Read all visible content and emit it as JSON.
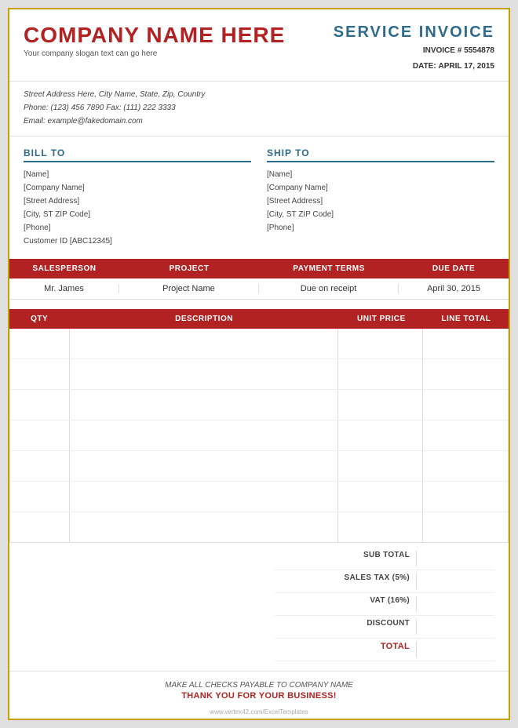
{
  "header": {
    "company_name": "COMPANY NAME HERE",
    "slogan": "Your company slogan text can go here",
    "invoice_title": "SERVICE  INVOICE",
    "invoice_number_label": "INVOICE #",
    "invoice_number": "5554878",
    "date_label": "DATE:",
    "date_value": "APRIL 17, 2015"
  },
  "contact": {
    "address": "Street Address Here, City Name, State, Zip, Country",
    "phone": "Phone: (123) 456 7890 Fax:  (111) 222 3333",
    "email": "Email: example@fakedomain.com"
  },
  "bill_to": {
    "title": "BILL TO",
    "lines": [
      "[Name]",
      "[Company Name]",
      "[Street Address]",
      "[City, ST  ZIP Code]",
      "[Phone]",
      "Customer ID [ABC12345]"
    ]
  },
  "ship_to": {
    "title": "SHIP TO",
    "lines": [
      "[Name]",
      "[Company Name]",
      "[Street Address]",
      "[City, ST  ZIP Code]",
      "[Phone]"
    ]
  },
  "info_table": {
    "headers": [
      "SALESPERSON",
      "PROJECT",
      "PAYMENT TERMS",
      "DUE DATE"
    ],
    "row": [
      "Mr. James",
      "Project Name",
      "Due on receipt",
      "April 30, 2015"
    ]
  },
  "items_table": {
    "headers": [
      "QTY",
      "DESCRIPTION",
      "UNIT PRICE",
      "LINE TOTAL"
    ],
    "rows": [
      {
        "qty": "",
        "desc": "",
        "unit": "",
        "total": ""
      },
      {
        "qty": "",
        "desc": "",
        "unit": "",
        "total": ""
      },
      {
        "qty": "",
        "desc": "",
        "unit": "",
        "total": ""
      },
      {
        "qty": "",
        "desc": "",
        "unit": "",
        "total": ""
      },
      {
        "qty": "",
        "desc": "",
        "unit": "",
        "total": ""
      },
      {
        "qty": "",
        "desc": "",
        "unit": "",
        "total": ""
      },
      {
        "qty": "",
        "desc": "",
        "unit": "",
        "total": ""
      }
    ]
  },
  "totals": {
    "sub_total_label": "SUB TOTAL",
    "sales_tax_label": "SALES TAX (5%)",
    "vat_label": "VAT (16%)",
    "discount_label": "DISCOUNT",
    "total_label": "TOTAL"
  },
  "footer": {
    "line1": "MAKE ALL CHECKS PAYABLE TO COMPANY NAME",
    "line2": "THANK YOU FOR YOUR BUSINESS!"
  }
}
